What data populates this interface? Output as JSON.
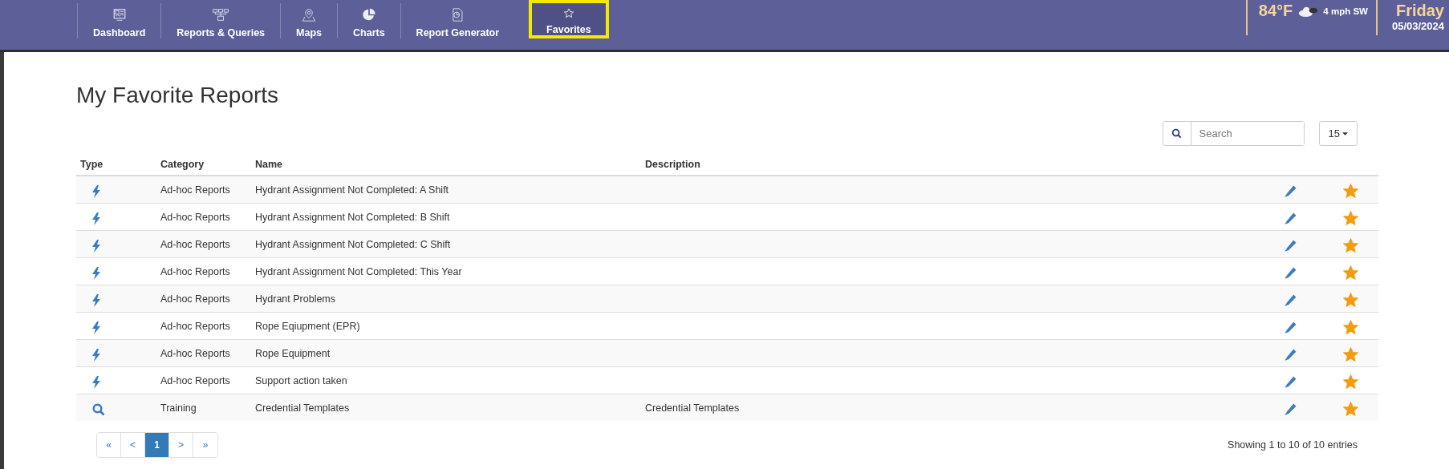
{
  "nav": [
    {
      "label": "Dashboard",
      "kind": "dashboard",
      "selected": false
    },
    {
      "label": "Reports & Queries",
      "kind": "reports",
      "selected": false
    },
    {
      "label": "Maps",
      "kind": "maps",
      "selected": false
    },
    {
      "label": "Charts",
      "kind": "charts",
      "selected": false
    },
    {
      "label": "Report Generator",
      "kind": "generator",
      "selected": false
    },
    {
      "label": "Favorites",
      "kind": "favorites",
      "selected": true
    }
  ],
  "weather": {
    "temperature": "84°F",
    "wind": "4 mph SW"
  },
  "date": {
    "day": "Friday",
    "date": "05/03/2024"
  },
  "title": "My Favorite Reports",
  "search": {
    "placeholder": "Search"
  },
  "page_size": "15",
  "table": {
    "columns": [
      "Type",
      "Category",
      "Name",
      "Description"
    ],
    "rows": [
      {
        "kind": "adhoc",
        "category": "Ad-hoc Reports",
        "name": "Hydrant Assignment Not Completed: A Shift",
        "description": "",
        "favorite": true
      },
      {
        "kind": "adhoc",
        "category": "Ad-hoc Reports",
        "name": "Hydrant Assignment Not Completed: B Shift",
        "description": "",
        "favorite": true
      },
      {
        "kind": "adhoc",
        "category": "Ad-hoc Reports",
        "name": "Hydrant Assignment Not Completed: C Shift",
        "description": "",
        "favorite": true
      },
      {
        "kind": "adhoc",
        "category": "Ad-hoc Reports",
        "name": "Hydrant Assignment Not Completed: This Year",
        "description": "",
        "favorite": true
      },
      {
        "kind": "adhoc",
        "category": "Ad-hoc Reports",
        "name": "Hydrant Problems",
        "description": "",
        "favorite": true
      },
      {
        "kind": "adhoc",
        "category": "Ad-hoc Reports",
        "name": "Rope Eqiupment (EPR)",
        "description": "",
        "favorite": true
      },
      {
        "kind": "adhoc",
        "category": "Ad-hoc Reports",
        "name": "Rope Equipment",
        "description": "",
        "favorite": true
      },
      {
        "kind": "adhoc",
        "category": "Ad-hoc Reports",
        "name": "Support action taken",
        "description": "",
        "favorite": true
      },
      {
        "kind": "query",
        "category": "Training",
        "name": "Credential Templates",
        "description": "Credential Templates",
        "favorite": true
      }
    ]
  },
  "pagination": [
    {
      "label": "«",
      "selected": false
    },
    {
      "label": "<",
      "selected": false
    },
    {
      "label": "1",
      "selected": true
    },
    {
      "label": ">",
      "selected": false
    },
    {
      "label": "»",
      "selected": false
    }
  ],
  "summary": "Showing 1 to 10 of 10 entries"
}
